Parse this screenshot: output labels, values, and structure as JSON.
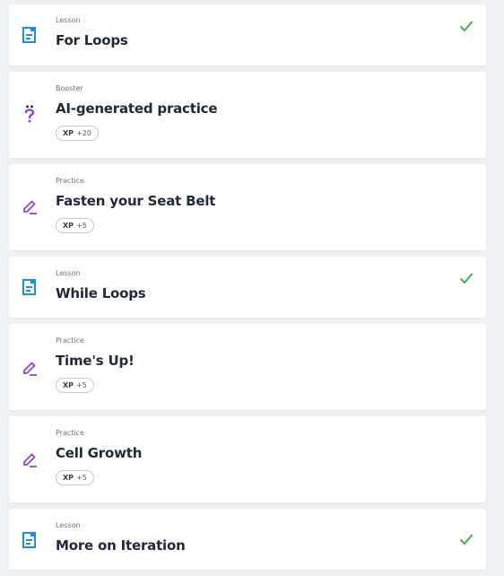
{
  "items": [
    {
      "kind": "Lesson",
      "title": "For Loops",
      "icon": "lesson-doc-icon",
      "completed": true
    },
    {
      "kind": "Booster",
      "title": "AI-generated practice",
      "icon": "question-icon",
      "xp_label": "XP",
      "xp_value": "+20"
    },
    {
      "kind": "Practice",
      "title": "Fasten your Seat Belt",
      "icon": "pencil-icon",
      "xp_label": "XP",
      "xp_value": "+5"
    },
    {
      "kind": "Lesson",
      "title": "While Loops",
      "icon": "lesson-doc-icon",
      "completed": true
    },
    {
      "kind": "Practice",
      "title": "Time's Up!",
      "icon": "pencil-icon",
      "xp_label": "XP",
      "xp_value": "+5"
    },
    {
      "kind": "Practice",
      "title": "Cell Growth",
      "icon": "pencil-icon",
      "xp_label": "XP",
      "xp_value": "+5"
    },
    {
      "kind": "Lesson",
      "title": "More on Iteration",
      "icon": "lesson-doc-icon",
      "completed": true
    }
  ],
  "colors": {
    "lesson_icon": "#1a8fe3",
    "practice_icon": "#8b45d6",
    "check": "#3ab54a"
  }
}
